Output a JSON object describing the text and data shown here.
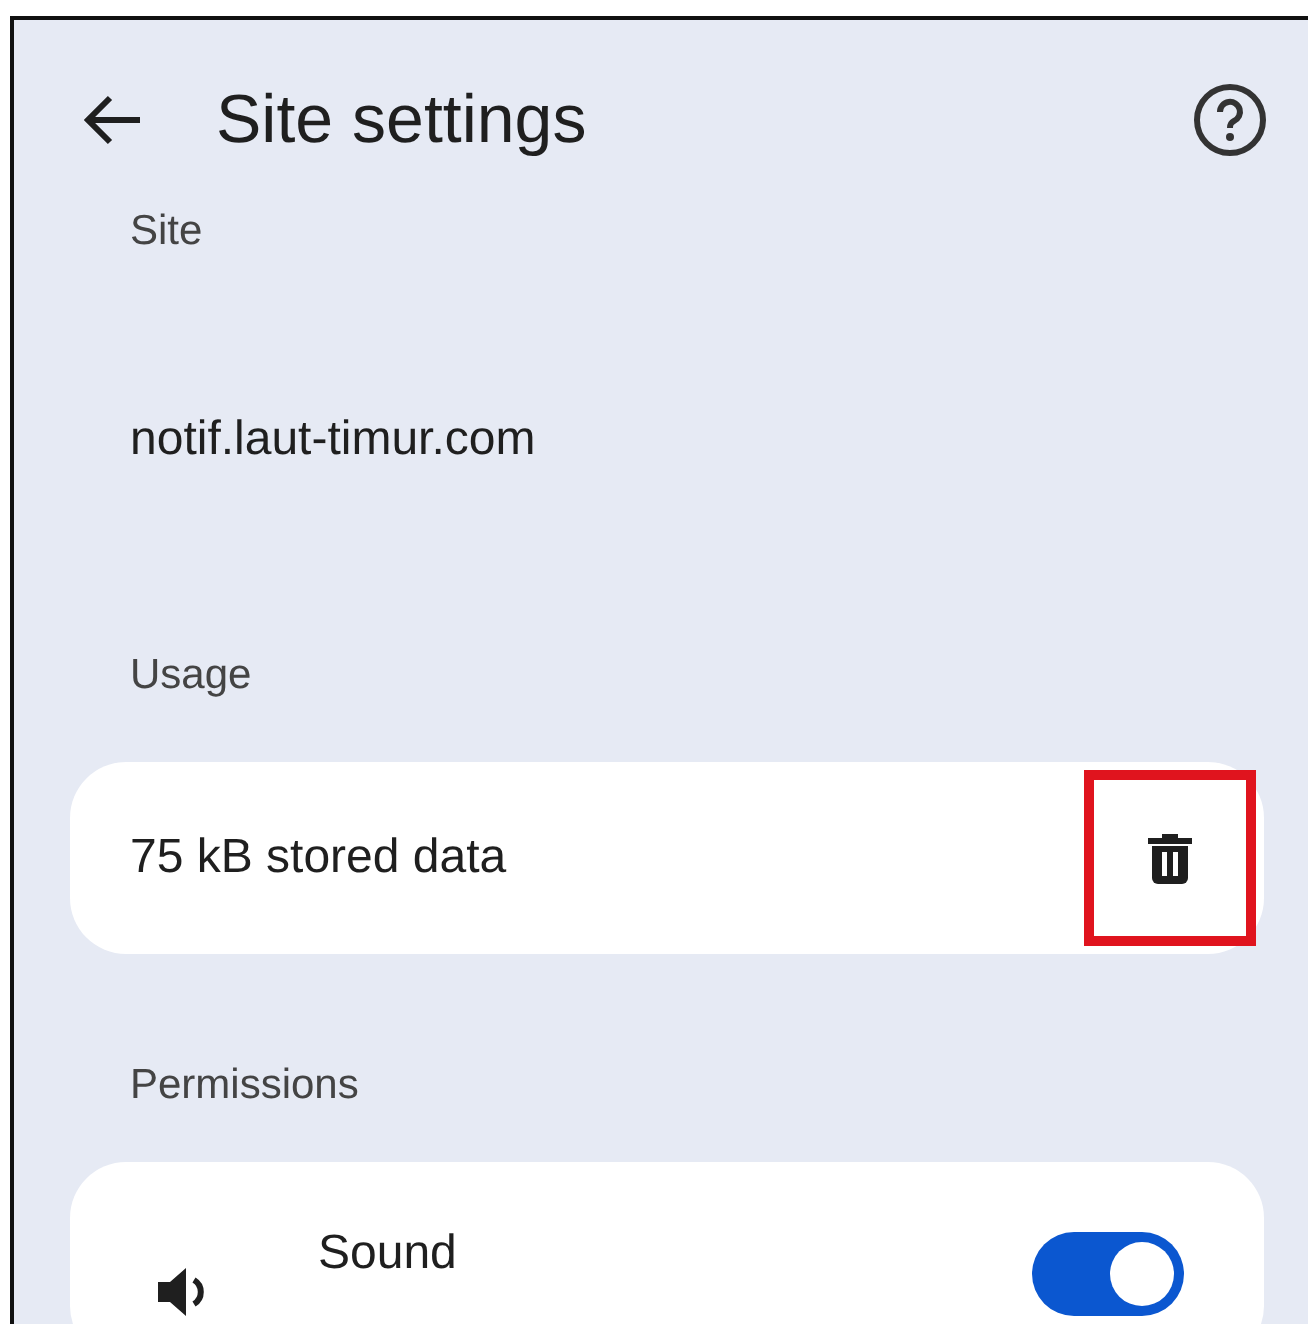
{
  "header": {
    "title": "Site settings"
  },
  "site": {
    "heading": "Site",
    "address": "notif.laut-timur.com"
  },
  "usage": {
    "heading": "Usage",
    "stored": "75 kB stored data",
    "delete_highlighted": true
  },
  "permissions": {
    "heading": "Permissions",
    "items": [
      {
        "label": "Sound",
        "on": true
      }
    ]
  }
}
